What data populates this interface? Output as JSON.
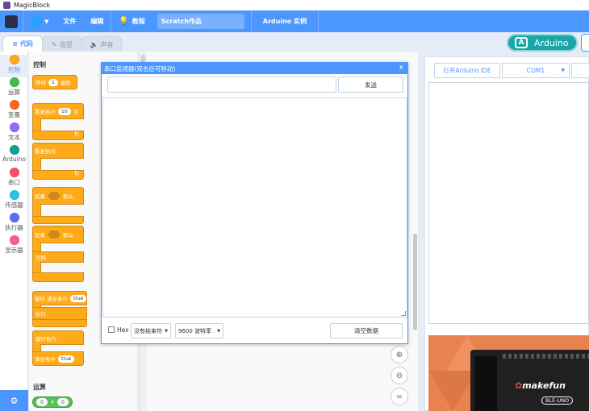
{
  "app": {
    "title": "MagicBlock"
  },
  "menubar": {
    "file": "文件",
    "edit": "编辑",
    "tutorial": "教程",
    "project_name": "Scratch作品",
    "arduino_lab": "Arduino 实例"
  },
  "tabs": [
    {
      "label": "代码",
      "active": true
    },
    {
      "label": "造型",
      "active": false
    },
    {
      "label": "声音",
      "active": false
    }
  ],
  "mode_button": {
    "label": "Arduino",
    "letter": "A"
  },
  "categories": [
    {
      "label": "控制",
      "color": "#ffab19",
      "active": true
    },
    {
      "label": "运算",
      "color": "#40bf4a"
    },
    {
      "label": "变量",
      "color": "#ff8c1a"
    },
    {
      "label": "文本",
      "color": "#9966ff"
    },
    {
      "label": "Arduino",
      "color": "#0fa096"
    },
    {
      "label": "串口",
      "color": "#ff4d6a"
    },
    {
      "label": "传感器",
      "color": "#2cc3e6"
    },
    {
      "label": "执行器",
      "color": "#5c6df2"
    },
    {
      "label": "显示器",
      "color": "#ff5c8a"
    }
  ],
  "palette": {
    "control_title": "控制",
    "operators_title": "运算",
    "wait": {
      "pre": "等待",
      "value": "1",
      "post": "毫秒"
    },
    "repeat": {
      "pre": "重复执行",
      "value": "10",
      "post": "次"
    },
    "forever": "重复执行",
    "if_then": {
      "pre": "如果",
      "post": "那么"
    },
    "if_else": {
      "pre": "如果",
      "post": "那么",
      "else": "否则"
    },
    "while_loop": {
      "pre": "循环 满足条件",
      "value": "true",
      "body": "执行"
    },
    "do_while": {
      "top": "循环执行",
      "cond": "满足条件",
      "value": "true"
    },
    "add": {
      "a": "0",
      "op": "+",
      "b": "0"
    }
  },
  "serial_monitor": {
    "title": "串口监视器(双击后可移动)",
    "close": "x",
    "send": "发送",
    "hex": "Hex",
    "line_ending": "没有结束符",
    "baud": "9600 波特率",
    "clear": "清空数据"
  },
  "right_panel": {
    "open_ide": "打开Arduino IDE",
    "port": "COM1",
    "board_brand": "makefun",
    "board_model": "BLE-UNO"
  }
}
